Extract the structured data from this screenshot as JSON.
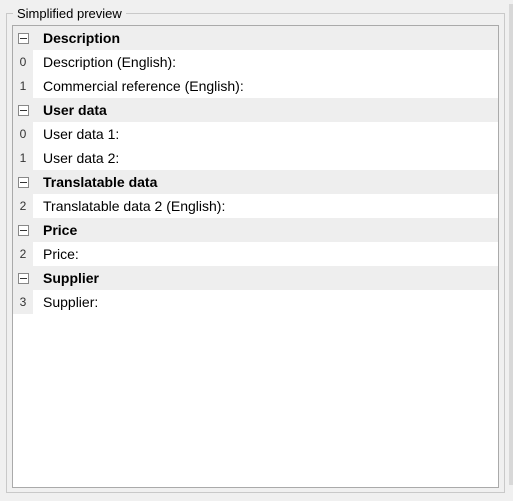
{
  "groupbox": {
    "title": "Simplified preview"
  },
  "sections": [
    {
      "title": "Description",
      "rows": [
        {
          "index": "0",
          "label": "Description (English):"
        },
        {
          "index": "1",
          "label": "Commercial reference (English):"
        }
      ]
    },
    {
      "title": "User data",
      "rows": [
        {
          "index": "0",
          "label": "User data 1:"
        },
        {
          "index": "1",
          "label": "User data 2:"
        }
      ]
    },
    {
      "title": "Translatable data",
      "rows": [
        {
          "index": "2",
          "label": "Translatable data 2 (English):"
        }
      ]
    },
    {
      "title": "Price",
      "rows": [
        {
          "index": "2",
          "label": "Price:"
        }
      ]
    },
    {
      "title": "Supplier",
      "rows": [
        {
          "index": "3",
          "label": "Supplier:"
        }
      ]
    }
  ]
}
